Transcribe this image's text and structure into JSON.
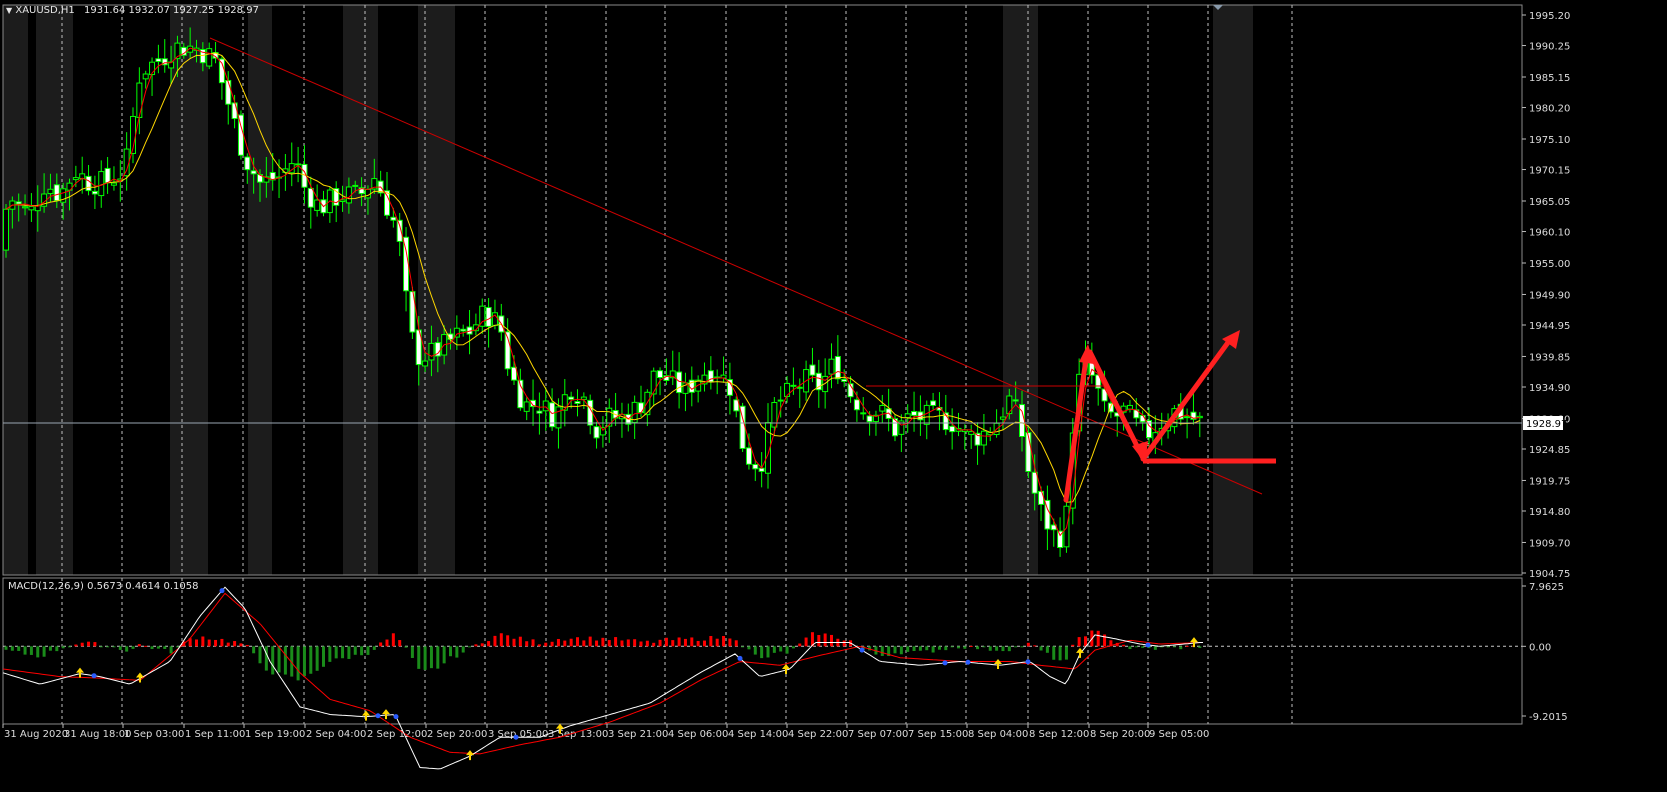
{
  "main_panel": {
    "symbol_title": "XAUUSD,H1",
    "ohlc_text": "1931.64 1932.07 1927.25 1928.97",
    "current_price_label": "1928.97",
    "price_ticks": [
      "1995.20",
      "1990.25",
      "1985.15",
      "1980.20",
      "1975.10",
      "1970.15",
      "1965.05",
      "1960.10",
      "1955.00",
      "1949.90",
      "1944.95",
      "1939.85",
      "1934.90",
      "1929.80",
      "1924.85",
      "1919.75",
      "1914.80",
      "1909.70",
      "1904.75"
    ]
  },
  "macd_panel": {
    "title": "MACD(12,26,9) 0.5673 0.4614 0.1058",
    "ticks": [
      "7.9625",
      "0.00",
      "-9.2015"
    ]
  },
  "time_axis": {
    "labels": [
      "31 Aug 2020",
      "31 Aug 18:00",
      "1 Sep 03:00",
      "1 Sep 11:00",
      "1 Sep 19:00",
      "2 Sep 04:00",
      "2 Sep 12:00",
      "2 Sep 20:00",
      "3 Sep 05:00",
      "3 Sep 13:00",
      "3 Sep 21:00",
      "4 Sep 06:00",
      "4 Sep 14:00",
      "4 Sep 22:00",
      "7 Sep 07:00",
      "7 Sep 15:00",
      "8 Sep 04:00",
      "8 Sep 12:00",
      "8 Sep 20:00",
      "9 Sep 05:00"
    ]
  },
  "colors": {
    "background": "#000000",
    "bull_candle": "#00ff00",
    "bear_candle": "#ffffff",
    "wick": "#00ff00",
    "session_band": "#1c1c1c",
    "ma_fast": "#ff0000",
    "ma_slow": "#ffd700",
    "trendline": "#cc0000",
    "drawn_arrows": "#ff2020",
    "histogram_up": "#ff0000",
    "histogram_down": "#1a8c1a",
    "macd_line": "#ffffff",
    "signal_line": "#ff0000",
    "buy_arrow": "#ffd700",
    "sell_dot": "#2a5cff",
    "grid": "#c0c0c0"
  }
}
